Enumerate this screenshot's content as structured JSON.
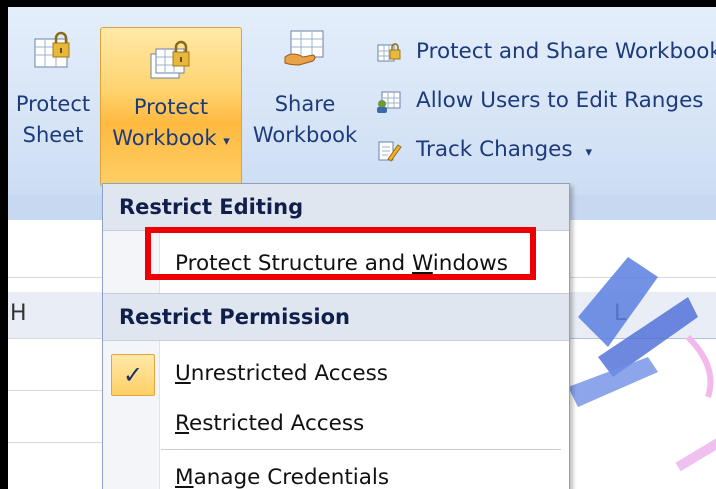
{
  "ribbon": {
    "protect_sheet": {
      "line1": "Protect",
      "line2": "Sheet",
      "icon": "lock-sheet-icon"
    },
    "protect_workbook": {
      "line1": "Protect",
      "line2": "Workbook",
      "arrow": "▾",
      "icon": "lock-workbook-icon"
    },
    "share_workbook": {
      "line1": "Share",
      "line2": "Workbook",
      "icon": "share-workbook-icon"
    },
    "small_buttons": [
      {
        "label": "Protect and Share Workbook",
        "icon": "protect-share-icon"
      },
      {
        "label": "Allow Users to Edit Ranges",
        "icon": "allow-users-icon"
      },
      {
        "label": "Track Changes",
        "arrow": "▾",
        "icon": "track-changes-icon"
      }
    ]
  },
  "columns": {
    "h": "H",
    "l": "L"
  },
  "menu": {
    "restrict_editing_header": "Restrict Editing",
    "protect_structure": {
      "before": "Protect Structure and ",
      "accel": "W",
      "after": "indows"
    },
    "restrict_permission_header": "Restrict Permission",
    "unrestricted": {
      "accel": "U",
      "rest": "nrestricted Access",
      "checked": true,
      "check_glyph": "✓"
    },
    "restricted": {
      "accel": "R",
      "rest": "estricted Access"
    },
    "manage": {
      "accel": "M",
      "rest": "anage Credentials"
    }
  },
  "colors": {
    "accent": "#ffcf66",
    "highlight": "#ee0000",
    "header_text": "#0f1e4a"
  }
}
